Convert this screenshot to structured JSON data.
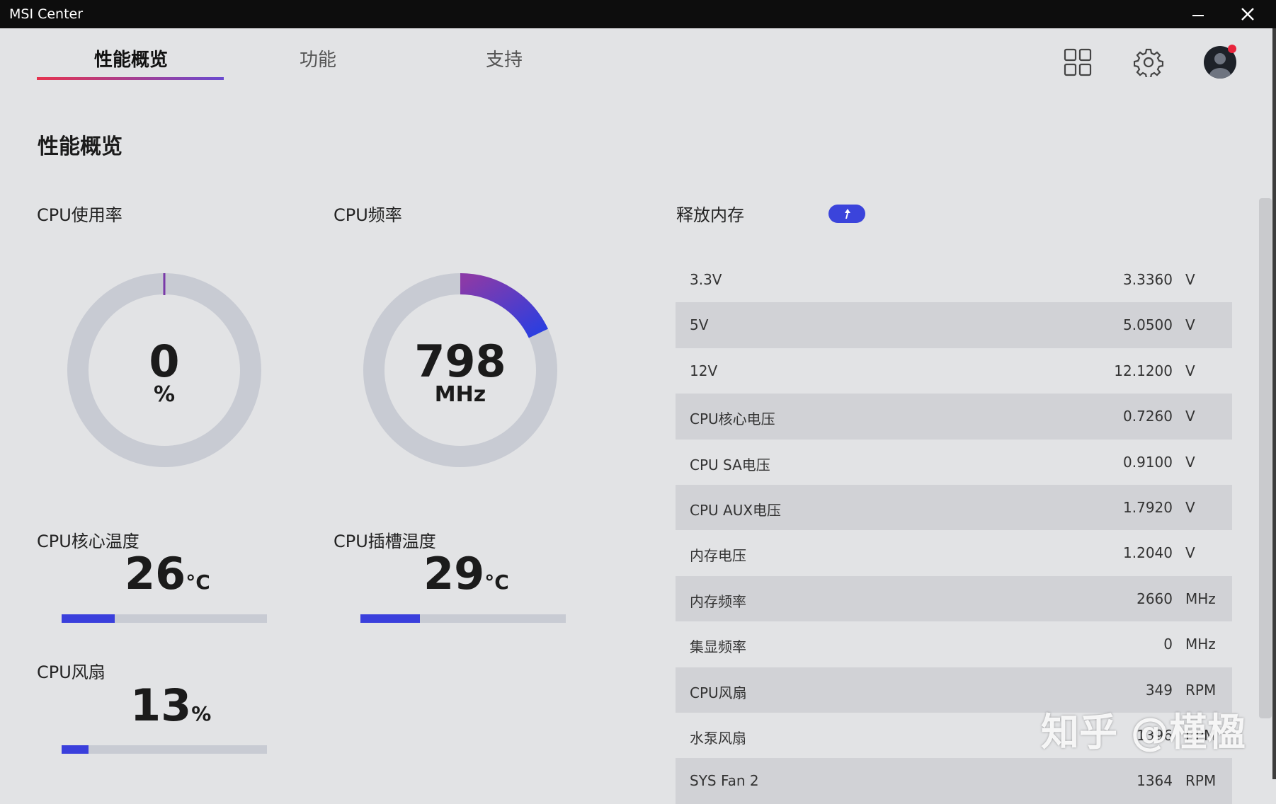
{
  "window": {
    "title": "MSI Center"
  },
  "tabs": [
    {
      "label": "性能概览"
    },
    {
      "label": "功能"
    },
    {
      "label": "支持"
    }
  ],
  "icons": {
    "grid": "grid-icon",
    "settings": "gear-icon",
    "avatar": "user-avatar-icon",
    "close": "close-icon",
    "minimize": "minimize-icon"
  },
  "page": {
    "title": "性能概览"
  },
  "cpu_usage": {
    "label": "CPU使用率",
    "value": "0",
    "unit": "%",
    "fraction": 0.0
  },
  "cpu_freq": {
    "label": "CPU频率",
    "value": "798",
    "unit": "MHz",
    "fraction": 0.18
  },
  "cpu_core_temp": {
    "label": "CPU核心温度",
    "value": "26",
    "unit": "°C",
    "fraction": 0.26
  },
  "cpu_socket_temp": {
    "label": "CPU插槽温度",
    "value": "29",
    "unit": "°C",
    "fraction": 0.29
  },
  "cpu_fan": {
    "label": "CPU风扇",
    "value": "13",
    "unit": "%",
    "fraction": 0.13
  },
  "release_memory": {
    "label": "释放内存"
  },
  "sensors": [
    {
      "name": "3.3V",
      "value": "3.3360",
      "unit": "V"
    },
    {
      "name": "5V",
      "value": "5.0500",
      "unit": "V"
    },
    {
      "name": "12V",
      "value": "12.1200",
      "unit": "V"
    },
    {
      "name": "CPU核心电压",
      "value": "0.7260",
      "unit": "V"
    },
    {
      "name": "CPU SA电压",
      "value": "0.9100",
      "unit": "V"
    },
    {
      "name": "CPU AUX电压",
      "value": "1.7920",
      "unit": "V"
    },
    {
      "name": "内存电压",
      "value": "1.2040",
      "unit": "V"
    },
    {
      "name": "内存频率",
      "value": "2660",
      "unit": "MHz"
    },
    {
      "name": "集显频率",
      "value": "0",
      "unit": "MHz"
    },
    {
      "name": "CPU风扇",
      "value": "349",
      "unit": "RPM"
    },
    {
      "name": "水泵风扇",
      "value": "1396",
      "unit": "RPM"
    },
    {
      "name": "SYS Fan 2",
      "value": "1364",
      "unit": "RPM"
    }
  ],
  "watermark": "知乎 @槿楹",
  "colors": {
    "accent": "#3b44db",
    "gauge_track": "#c8cbd3",
    "tab_gradient_start": "#e6334f",
    "tab_gradient_end": "#6a4ad0"
  }
}
